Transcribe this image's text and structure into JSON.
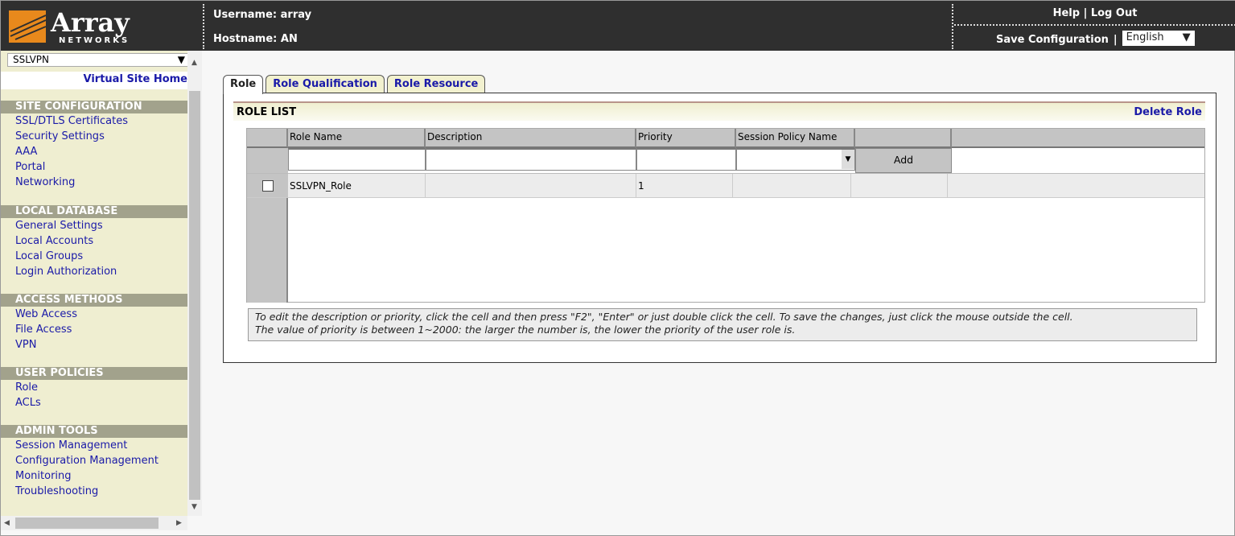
{
  "header": {
    "logo_text": "Array",
    "logo_sub": "NETWORKS",
    "username": "Username: array",
    "hostname": "Hostname: AN",
    "help": "Help",
    "separator": "|",
    "logout": "Log Out",
    "save_config": "Save Configuration",
    "language": "English"
  },
  "sidebar": {
    "site_select": "SSLVPN",
    "virtual_site_home": "Virtual Site Home",
    "sections": [
      {
        "title": "SITE CONFIGURATION",
        "items": [
          "SSL/DTLS Certificates",
          "Security Settings",
          "AAA",
          "Portal",
          "Networking"
        ]
      },
      {
        "title": "LOCAL DATABASE",
        "items": [
          "General Settings",
          "Local Accounts",
          "Local Groups",
          "Login Authorization"
        ]
      },
      {
        "title": "ACCESS METHODS",
        "items": [
          "Web Access",
          "File Access",
          "VPN"
        ]
      },
      {
        "title": "USER POLICIES",
        "items": [
          "Role",
          "ACLs"
        ]
      },
      {
        "title": "ADMIN TOOLS",
        "items": [
          "Session Management",
          "Configuration Management",
          "Monitoring",
          "Troubleshooting"
        ]
      }
    ]
  },
  "tabs": [
    "Role",
    "Role Qualification",
    "Role Resource"
  ],
  "role_list": {
    "title": "ROLE LIST",
    "delete": "Delete Role",
    "columns": [
      "Role Name",
      "Description",
      "Priority",
      "Session Policy Name"
    ],
    "add": "Add",
    "rows": [
      {
        "name": "SSLVPN_Role",
        "description": "",
        "priority": "1",
        "session_policy": ""
      }
    ]
  },
  "note": [
    "To edit the description or priority, click the cell and then press \"F2\", \"Enter\" or just double click the cell. To save the changes, just click the mouse outside the cell.",
    "The value of priority is between 1~2000: the larger the number is, the lower the priority of the user role is."
  ]
}
